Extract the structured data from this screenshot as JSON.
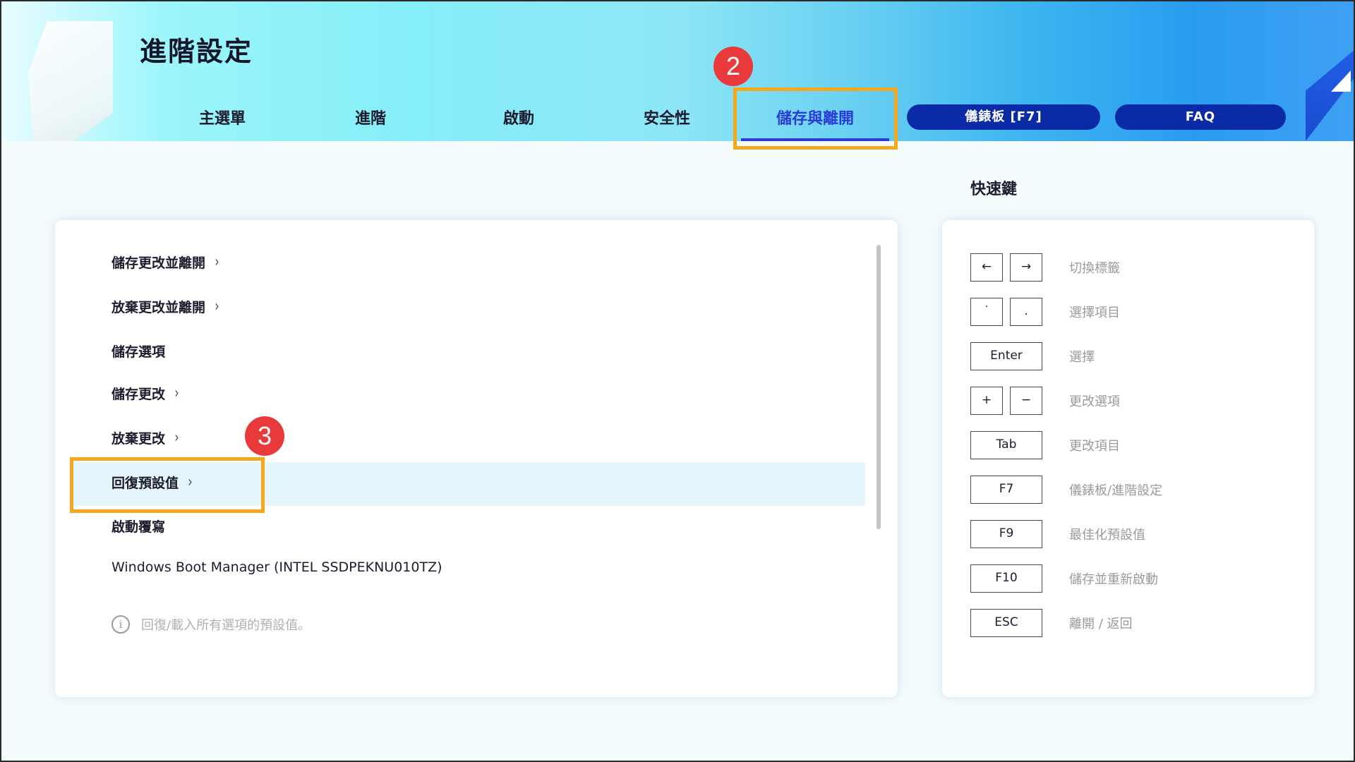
{
  "page_title": "進階設定",
  "tabs": [
    {
      "label": "主選單"
    },
    {
      "label": "進階"
    },
    {
      "label": "啟動"
    },
    {
      "label": "安全性"
    },
    {
      "label": "儲存與離開"
    }
  ],
  "active_tab": "儲存與離開",
  "pills": {
    "dashboard": "儀錶板 [F7]",
    "faq": "FAQ"
  },
  "step_badges": {
    "step2": "2",
    "step3": "3"
  },
  "menu": {
    "items": [
      {
        "label": "儲存更改並離開",
        "chevron": "›"
      },
      {
        "label": "放棄更改並離開",
        "chevron": "›"
      },
      {
        "label": "儲存選項"
      },
      {
        "label": "儲存更改",
        "chevron": "›"
      },
      {
        "label": "放棄更改",
        "chevron": "›"
      },
      {
        "label": "回復預設值",
        "chevron": "›"
      },
      {
        "label": "啟動覆寫"
      },
      {
        "label": "Windows Boot Manager (INTEL SSDPEKNU010TZ)"
      }
    ],
    "selected_index": 5,
    "info_text": "回復/載入所有選項的預設值。"
  },
  "hotkeys": {
    "title": "快速鍵",
    "rows": [
      {
        "keys": [
          "←",
          "→"
        ],
        "desc": "切換標籤"
      },
      {
        "keys": [
          "˙",
          "."
        ],
        "desc": "選擇項目"
      },
      {
        "keys": [
          "Enter"
        ],
        "desc": "選擇"
      },
      {
        "keys": [
          "+",
          "−"
        ],
        "desc": "更改選項"
      },
      {
        "keys": [
          "Tab"
        ],
        "desc": "更改項目"
      },
      {
        "keys": [
          "F7"
        ],
        "desc": "儀錶板/進階設定"
      },
      {
        "keys": [
          "F9"
        ],
        "desc": "最佳化預設值"
      },
      {
        "keys": [
          "F10"
        ],
        "desc": "儲存並重新啟動"
      },
      {
        "keys": [
          "ESC"
        ],
        "desc": "離開 / 返回"
      }
    ]
  },
  "colors": {
    "active_tab": "#2b3bd6",
    "pill_bg": "#0b2aa6",
    "highlight": "#f5a81c",
    "badge": "#e83a3a",
    "selected_row": "#e4f6fc"
  }
}
